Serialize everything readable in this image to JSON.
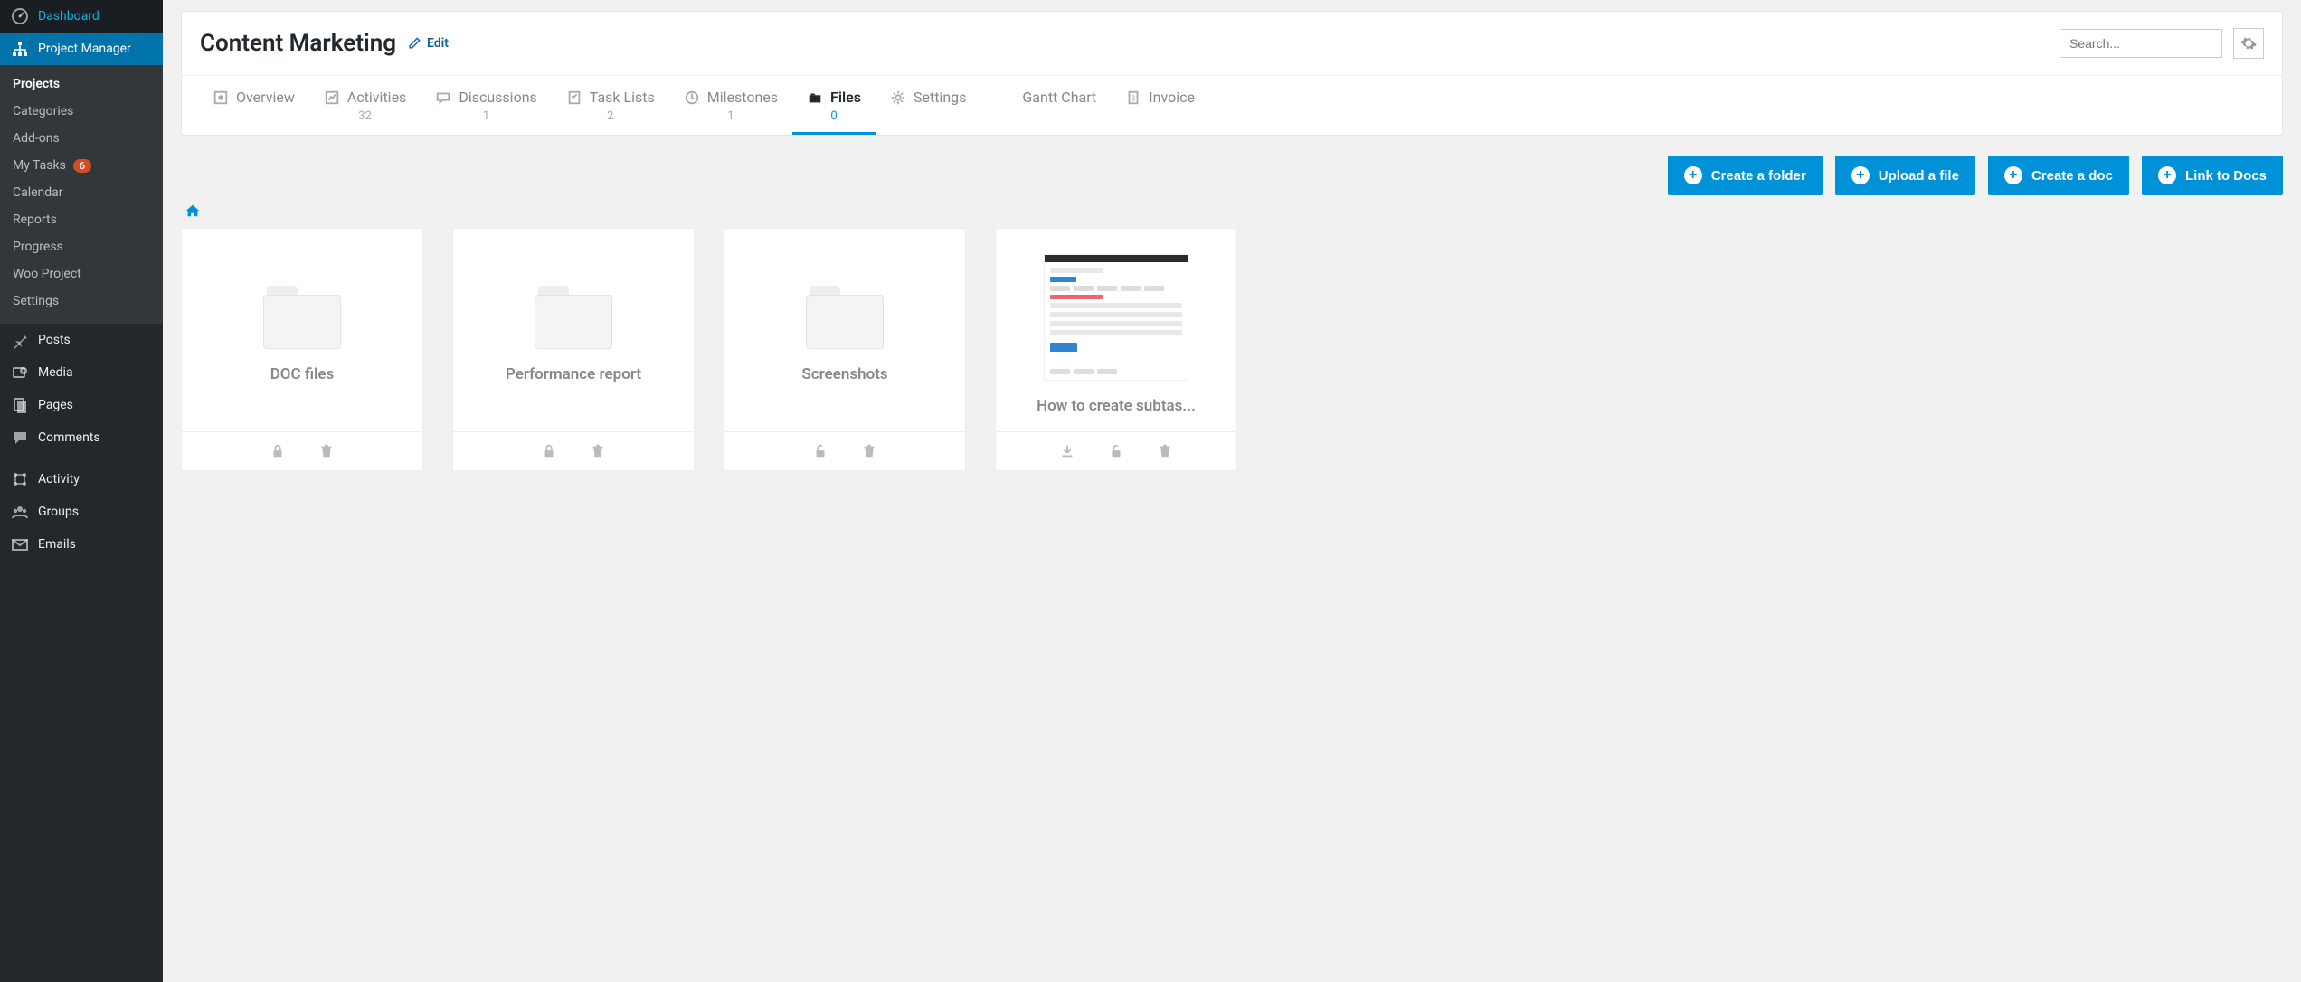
{
  "sidebar": {
    "dashboard": "Dashboard",
    "project_manager": "Project Manager",
    "sub": {
      "projects": "Projects",
      "categories": "Categories",
      "addons": "Add-ons",
      "my_tasks": "My Tasks",
      "my_tasks_badge": "6",
      "calendar": "Calendar",
      "reports": "Reports",
      "progress": "Progress",
      "woo_project": "Woo Project",
      "settings": "Settings"
    },
    "posts": "Posts",
    "media": "Media",
    "pages": "Pages",
    "comments": "Comments",
    "activity": "Activity",
    "groups": "Groups",
    "emails": "Emails"
  },
  "header": {
    "title": "Content Marketing",
    "edit": "Edit",
    "search_placeholder": "Search..."
  },
  "tabs": {
    "overview": {
      "label": "Overview"
    },
    "activities": {
      "label": "Activities",
      "count": "32"
    },
    "discussions": {
      "label": "Discussions",
      "count": "1"
    },
    "task_lists": {
      "label": "Task Lists",
      "count": "2"
    },
    "milestones": {
      "label": "Milestones",
      "count": "1"
    },
    "files": {
      "label": "Files",
      "count": "0"
    },
    "settings": {
      "label": "Settings"
    },
    "gantt": {
      "label": "Gantt Chart"
    },
    "invoice": {
      "label": "Invoice"
    }
  },
  "actions": {
    "create_folder": "Create a folder",
    "upload_file": "Upload a file",
    "create_doc": "Create a doc",
    "link_docs": "Link to Docs"
  },
  "cards": {
    "doc_files": "DOC files",
    "performance": "Performance report",
    "screenshots": "Screenshots",
    "howto": "How to create subtas..."
  }
}
